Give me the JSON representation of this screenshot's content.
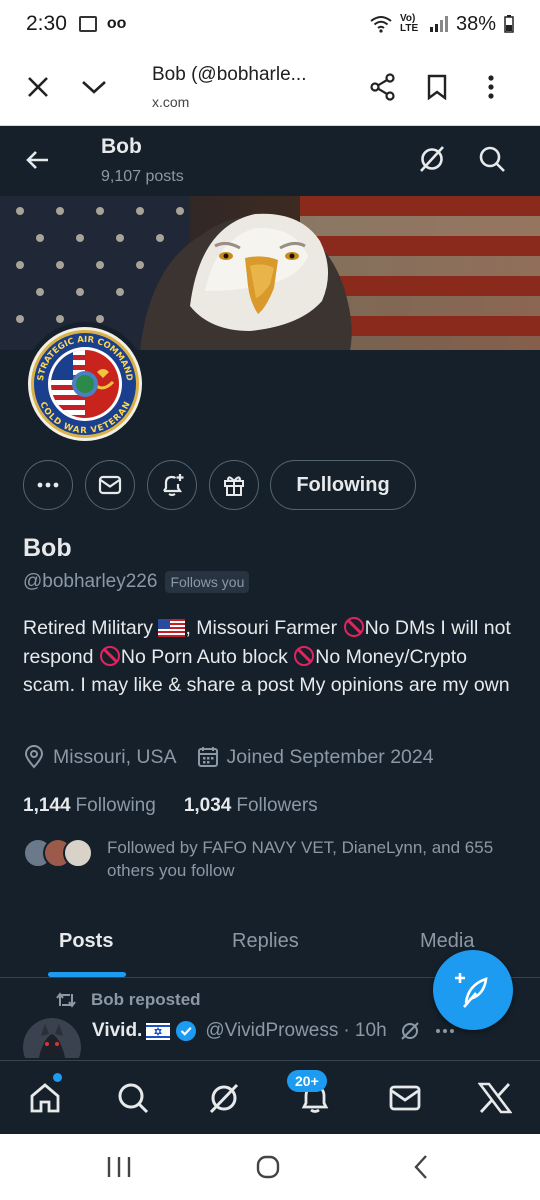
{
  "status_bar": {
    "time": "2:30",
    "battery": "38%",
    "network": "Vo) LTE"
  },
  "browser": {
    "title": "Bob (@bobharle...",
    "url": "x.com"
  },
  "header": {
    "name": "Bob",
    "posts": "9,107 posts"
  },
  "profile": {
    "name": "Bob",
    "handle": "@bobharley226",
    "follows_you": "Follows you",
    "follow_button": "Following",
    "bio": {
      "p1": "Retired Military",
      "p2": ", Missouri Farmer",
      "p3": "No DMs I will not respond",
      "p4": "No Porn Auto block",
      "p5": "No Money/Crypto scam. I may like & share a post My opinions are my own"
    },
    "location": "Missouri, USA",
    "joined": "Joined September 2024",
    "following_count": "1,144",
    "following_label": "Following",
    "followers_count": "1,034",
    "followers_label": "Followers",
    "followed_by": "Followed by FAFO NAVY VET, DianeLynn, and 655 others you follow",
    "avatar_text_top": "STRATEGIC AIR COMMAND",
    "avatar_text_bottom": "COLD WAR VETERAN"
  },
  "tabs": [
    {
      "label": "Posts",
      "active": true
    },
    {
      "label": "Replies",
      "active": false
    },
    {
      "label": "Media",
      "active": false
    }
  ],
  "post": {
    "repost_label": "Bob reposted",
    "author_name": "Vivid.",
    "author_handle": "@VividProwess",
    "time": "· 10h"
  },
  "nav": {
    "notifications_badge": "20+"
  },
  "colors": {
    "accent": "#1d9bf0",
    "background": "#15202b",
    "muted": "#8b98a5"
  }
}
